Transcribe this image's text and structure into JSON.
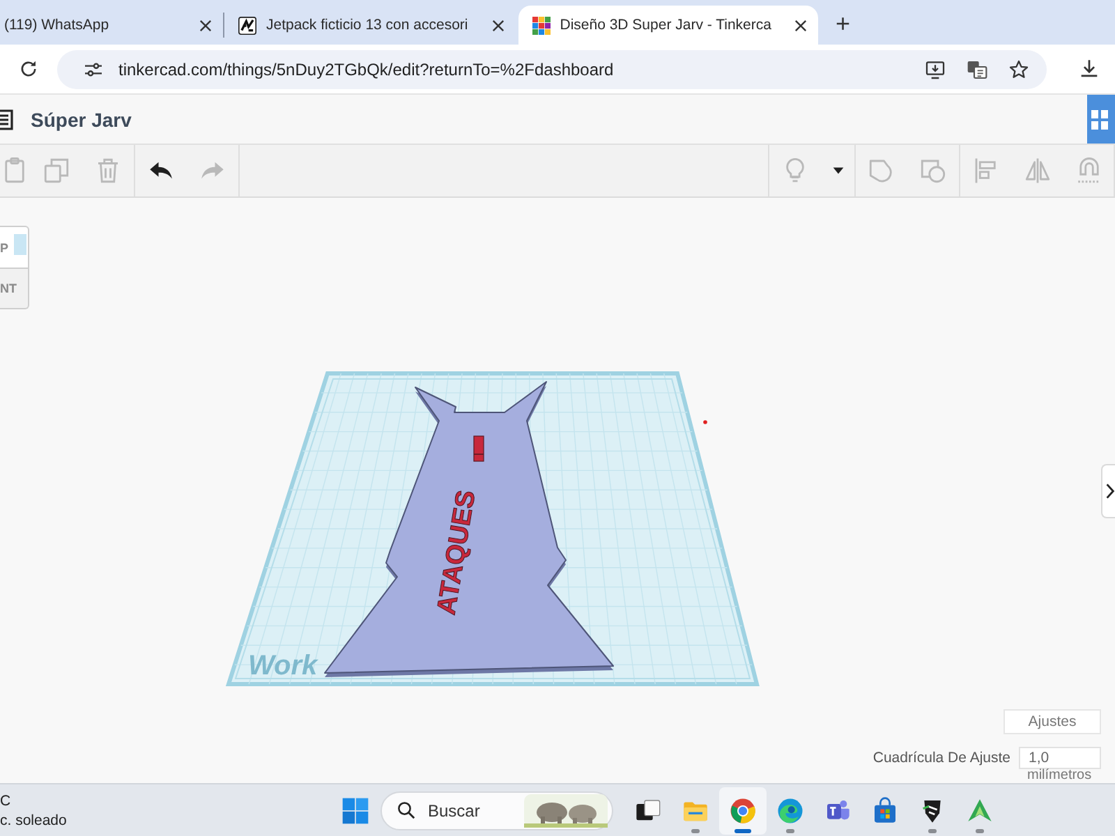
{
  "browser": {
    "tabs": [
      {
        "title": "(119) WhatsApp",
        "kind": "none",
        "selected": false
      },
      {
        "title": "Jetpack ficticio 13 con accesori",
        "kind": "sketch",
        "selected": false
      },
      {
        "title": "Diseño 3D Super Jarv - Tinkerca",
        "kind": "tiles",
        "selected": true
      }
    ],
    "new_tab": "+",
    "address": "tinkercad.com/things/5nDuy2TGbQk/edit?returnTo=%2Fdashboard"
  },
  "editor": {
    "title": "Súper Jarv"
  },
  "toolbar": {
    "left": [
      [
        {
          "kind": "paste",
          "disabled": true
        },
        {
          "kind": "duplicate",
          "disabled": true
        },
        {
          "kind": "delete",
          "disabled": true
        }
      ],
      [
        {
          "kind": "undo",
          "disabled": false
        },
        {
          "kind": "redo",
          "disabled": true
        }
      ]
    ],
    "right": [
      [
        {
          "kind": "light",
          "disabled": true
        },
        {
          "kind": "dropdown",
          "disabled": false
        }
      ],
      [
        {
          "kind": "group",
          "disabled": true
        },
        {
          "kind": "ungroup",
          "disabled": true
        }
      ],
      [
        {
          "kind": "align",
          "disabled": true
        },
        {
          "kind": "mirror",
          "disabled": true
        },
        {
          "kind": "cruise",
          "disabled": true
        }
      ]
    ]
  },
  "canvas": {
    "view_cube": {
      "top": "P",
      "front": "NT"
    },
    "workplane": {
      "label": "Work"
    },
    "model": {
      "text": "ATAQUES"
    },
    "settings": {
      "button": "Ajustes",
      "snap_grid": {
        "label": "Cuadrícula De Ajuste",
        "value": "1,0",
        "unit": "milímetros"
      }
    }
  },
  "taskbar": {
    "weather": {
      "temperature": "C",
      "condition": "c. soleado"
    },
    "search": {
      "placeholder": "Buscar"
    },
    "apps": [
      {
        "kind": "taskview",
        "running": false,
        "selected": false
      },
      {
        "kind": "explorer",
        "running": true,
        "selected": false
      },
      {
        "kind": "chrome",
        "running": true,
        "selected": true
      },
      {
        "kind": "edge",
        "running": true,
        "selected": false
      },
      {
        "kind": "teams",
        "running": false,
        "selected": false
      },
      {
        "kind": "store",
        "running": false,
        "selected": false
      },
      {
        "kind": "shield",
        "running": true,
        "selected": false
      },
      {
        "kind": "arrow",
        "running": true,
        "selected": false
      }
    ]
  }
}
